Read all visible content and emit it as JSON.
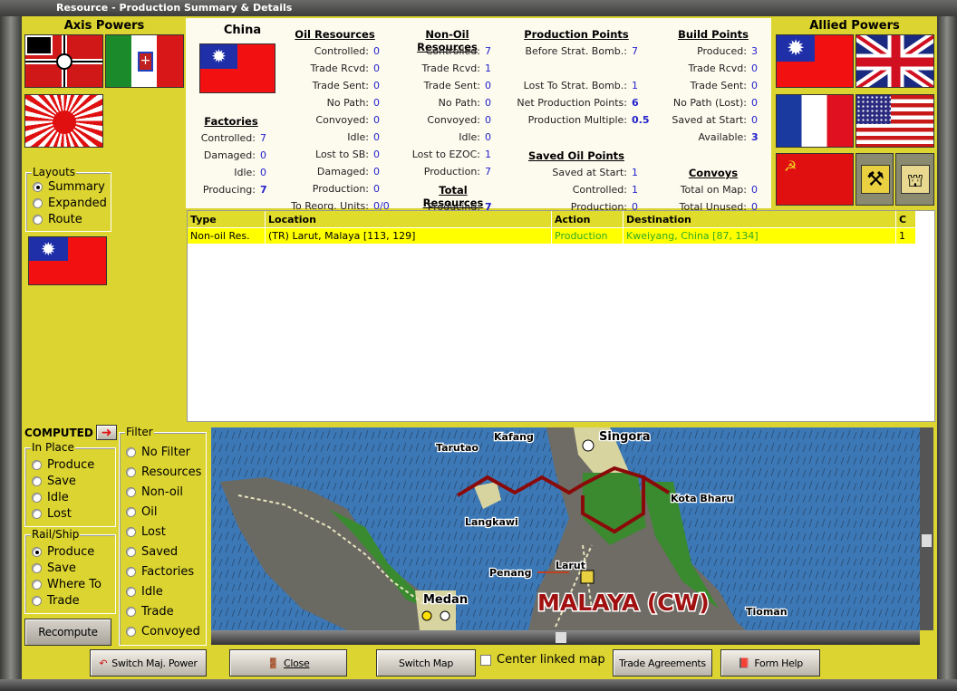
{
  "window": {
    "title": "Resource - Production Summary & Details"
  },
  "axis": {
    "title": "Axis Powers",
    "flags": [
      "germany",
      "italy",
      "japan"
    ]
  },
  "allied": {
    "title": "Allied Powers",
    "flags": [
      "china",
      "united-kingdom",
      "france",
      "united-states",
      "soviet-union"
    ],
    "icons": [
      "resource-icon",
      "oil-icon"
    ]
  },
  "layouts": {
    "title": "Layouts",
    "options": [
      "Summary",
      "Expanded",
      "Route"
    ],
    "selected": "Summary"
  },
  "country": {
    "name": "China"
  },
  "stats": {
    "factories": {
      "title": "Factories",
      "rows": [
        {
          "label": "Controlled:",
          "value": "7"
        },
        {
          "label": "Damaged:",
          "value": "0"
        },
        {
          "label": "Idle:",
          "value": "0"
        },
        {
          "label": "Producing:",
          "value": "7",
          "bold": true
        }
      ]
    },
    "oil": {
      "title": "Oil Resources",
      "rows": [
        {
          "label": "Controlled:",
          "value": "0"
        },
        {
          "label": "Trade Rcvd:",
          "value": "0"
        },
        {
          "label": "Trade Sent:",
          "value": "0"
        },
        {
          "label": "No Path:",
          "value": "0"
        },
        {
          "label": "Convoyed:",
          "value": "0"
        },
        {
          "label": "Idle:",
          "value": "0"
        },
        {
          "label": "Lost to SB:",
          "value": "0"
        },
        {
          "label": "Damaged:",
          "value": "0"
        },
        {
          "label": "Production:",
          "value": "0"
        },
        {
          "label": "To Reorg. Units:",
          "value": "0/0"
        }
      ]
    },
    "nonoil": {
      "title": "Non-Oil Resources",
      "rows": [
        {
          "label": "Controlled:",
          "value": "7"
        },
        {
          "label": "Trade Rcvd:",
          "value": "1"
        },
        {
          "label": "Trade Sent:",
          "value": "0"
        },
        {
          "label": "No Path:",
          "value": "0"
        },
        {
          "label": "Convoyed:",
          "value": "0"
        },
        {
          "label": "Idle:",
          "value": "0"
        },
        {
          "label": "Lost to EZOC:",
          "value": "1"
        },
        {
          "label": "Production:",
          "value": "7"
        }
      ]
    },
    "total": {
      "title": "Total Resources",
      "rows": [
        {
          "label": "Producing:",
          "value": "7",
          "bold": true
        }
      ]
    },
    "production": {
      "title": "Production Points",
      "rows": [
        {
          "label": "Before Strat. Bomb.:",
          "value": "7"
        },
        {
          "label": "",
          "value": ""
        },
        {
          "label": "Lost To Strat. Bomb.:",
          "value": "1"
        },
        {
          "label": "Net Production Points:",
          "value": "6",
          "bold": true
        },
        {
          "label": "Production Multiple:",
          "value": "0.5",
          "bold": true
        }
      ]
    },
    "savedoil": {
      "title": "Saved Oil Points",
      "rows": [
        {
          "label": "Saved at Start:",
          "value": "1"
        },
        {
          "label": "Controlled:",
          "value": "1"
        },
        {
          "label": "Production:",
          "value": "0"
        }
      ]
    },
    "build": {
      "title": "Build Points",
      "rows": [
        {
          "label": "Produced:",
          "value": "3"
        },
        {
          "label": "Trade Rcvd:",
          "value": "0"
        },
        {
          "label": "Trade Sent:",
          "value": "0"
        },
        {
          "label": "No Path (Lost):",
          "value": "0"
        },
        {
          "label": "Saved at Start:",
          "value": "0"
        },
        {
          "label": "Available:",
          "value": "3",
          "bold": true
        }
      ]
    },
    "convoys": {
      "title": "Convoys",
      "rows": [
        {
          "label": "Total on Map:",
          "value": "0"
        },
        {
          "label": "Total Unused:",
          "value": "0"
        }
      ]
    }
  },
  "table": {
    "columns": [
      "Type",
      "Location",
      "Action",
      "Destination",
      "C"
    ],
    "rows": [
      [
        "Non-oil Res.",
        "(TR) Larut, Malaya [113, 129]",
        "Production",
        "Kweiyang, China [87, 134]",
        "1"
      ]
    ]
  },
  "computed": {
    "label": "COMPUTED"
  },
  "in_place": {
    "title": "In Place",
    "options": [
      "Produce",
      "Save",
      "Idle",
      "Lost"
    ]
  },
  "rail_ship": {
    "title": "Rail/Ship",
    "options": [
      "Produce",
      "Save",
      "Where To",
      "Trade"
    ],
    "selected": "Produce"
  },
  "filter": {
    "title": "Filter",
    "options": [
      "No Filter",
      "Resources",
      "Non-oil",
      "Oil",
      "Lost",
      "Saved",
      "Factories",
      "Idle",
      "Trade",
      "Convoyed"
    ]
  },
  "recompute_label": "Recompute",
  "map": {
    "labels": [
      "Kafang",
      "Singora",
      "Tarutao",
      "Kota Bharu",
      "Langkawi",
      "Penang",
      "Larut",
      "Medan",
      "MALAYA (CW)",
      "Tioman"
    ]
  },
  "buttons": {
    "switch_power": "Switch Maj. Power",
    "close": "Close",
    "switch_map": "Switch Map",
    "center_linked": "Center linked map",
    "trade": "Trade Agreements",
    "help": "Form Help"
  },
  "colors": {
    "panel": "#dcd430",
    "row_highlight": "#ffff00",
    "value": "#2222cc",
    "action": "#33aa22",
    "border_hex": "#8a0a0a"
  }
}
